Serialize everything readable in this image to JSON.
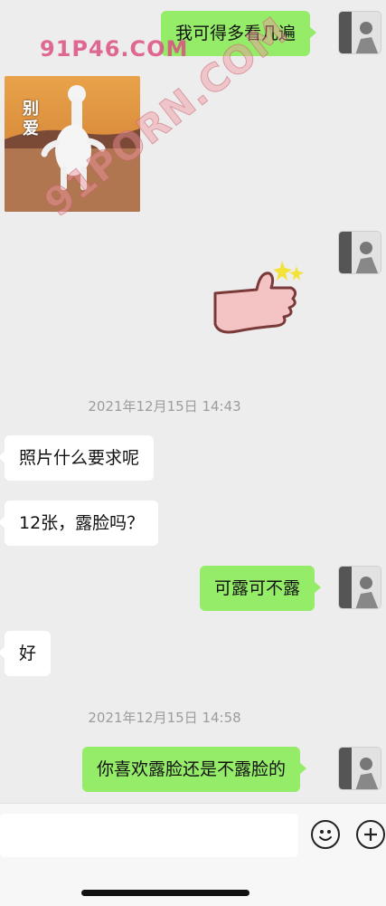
{
  "watermarks": {
    "top": "91P46.COM",
    "diagonal": "91PORN.COM"
  },
  "sticker_text": "别\n爱",
  "messages": {
    "m1": "我可得多看几遍",
    "time1": "2021年12月15日 14:43",
    "m2": "照片什么要求呢",
    "m3": "12张，露脸吗？",
    "m4": "可露可不露",
    "m5": "好",
    "time2": "2021年12月15日 14:58",
    "m6": "你喜欢露脸还是不露脸的"
  },
  "input": {
    "value": "",
    "emoji_icon": "emoji-icon",
    "plus_icon": "plus-icon"
  }
}
